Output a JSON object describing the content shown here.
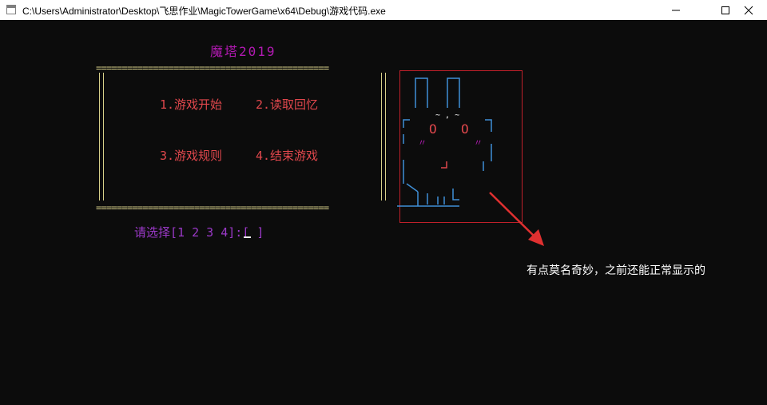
{
  "window": {
    "title": "C:\\Users\\Administrator\\Desktop\\飞思作业\\MagicTowerGame\\x64\\Debug\\游戏代码.exe"
  },
  "console": {
    "heading": "魔塔2019",
    "rule": "=============================================",
    "menu": [
      "1.游戏开始",
      "2.读取回忆",
      "3.游戏规则",
      "4.结束游戏"
    ],
    "prompt": "请选择[1 2 3 4]:[",
    "prompt_close": "]"
  },
  "ascii_art": {
    "ear_marks": "~ , ~",
    "eyes": [
      "O",
      "O"
    ],
    "blush": [
      "〃",
      "〃"
    ]
  },
  "annotation": {
    "text": "有点莫名奇妙，之前还能正常显示的"
  },
  "colors": {
    "background": "#0c0c0c",
    "heading": "#b21ab2",
    "frame": "#d7d08a",
    "menu": "#e0474c",
    "prompt": "#9b39c8",
    "art": "#3f8fd6",
    "highlight": "#c0202a"
  }
}
